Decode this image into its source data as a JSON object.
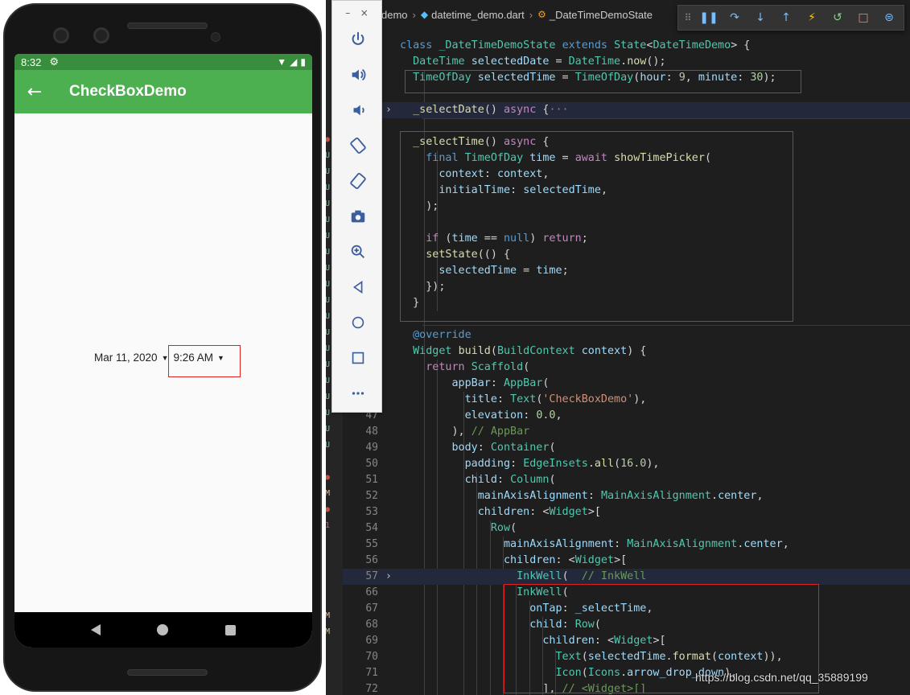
{
  "phone": {
    "status_time": "8:32",
    "app_title": "CheckBoxDemo",
    "date_value": "Mar 11, 2020",
    "time_value": "9:26 AM"
  },
  "emulator_toolbar": {
    "minimize": "–",
    "close": "×",
    "buttons": [
      "power-icon",
      "volume-up-icon",
      "volume-down-icon",
      "rotate-left-icon",
      "rotate-right-icon",
      "camera-icon",
      "zoom-icon",
      "back-icon",
      "home-icon",
      "overview-icon",
      "more-icon"
    ]
  },
  "editor": {
    "breadcrumb": [
      "demo",
      "datetime_demo.dart",
      "_DateTimeDemoState"
    ],
    "debug_toolbar": [
      "grip-icon",
      "pause-icon",
      "step-over-icon",
      "step-into-icon",
      "step-out-icon",
      "hot-reload-icon",
      "restart-icon",
      "stop-icon",
      "devtools-icon"
    ],
    "line_numbers": [
      "47",
      "48",
      "49",
      "50",
      "51",
      "52",
      "53",
      "54",
      "55",
      "56",
      "57",
      "66",
      "67",
      "68",
      "69",
      "70",
      "71",
      "72"
    ],
    "lines": [
      "class _DateTimeDemoState extends State<DateTimeDemo> {",
      "  DateTime selectedDate = DateTime.now();",
      "  TimeOfDay selectedTime = TimeOfDay(hour: 9, minute: 30);",
      "",
      "  _selectDate() async {···",
      "",
      "  _selectTime() async {",
      "    final TimeOfDay time = await showTimePicker(",
      "      context: context,",
      "      initialTime: selectedTime,",
      "    );",
      "",
      "    if (time == null) return;",
      "    setState(() {",
      "      selectedTime = time;",
      "    });",
      "  }",
      "",
      "  @override",
      "  Widget build(BuildContext context) {",
      "    return Scaffold(",
      "        appBar: AppBar(",
      "          title: Text('CheckBoxDemo'),",
      "          elevation: 0.0,",
      "        ), // AppBar",
      "        body: Container(",
      "          padding: EdgeInsets.all(16.0),",
      "          child: Column(",
      "            mainAxisAlignment: MainAxisAlignment.center,",
      "            children: <Widget>[",
      "              Row(",
      "                mainAxisAlignment: MainAxisAlignment.center,",
      "                children: <Widget>[",
      "                  InkWell( // InkWell",
      "                  InkWell(",
      "                    onTap: _selectTime,",
      "                    child: Row(",
      "                      children: <Widget>[",
      "                        Text(selectedTime.format(context)),",
      "                        Icon(Icons.arrow_drop_down),",
      "                      ], // <Widget>[]"
    ]
  },
  "watermark": "https://blog.csdn.net/qq_35889199"
}
